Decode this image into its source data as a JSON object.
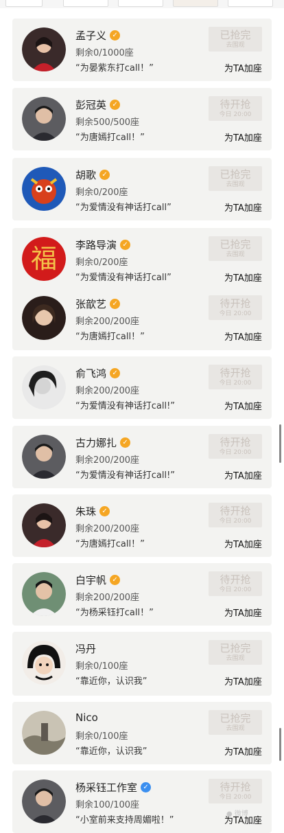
{
  "items": [
    {
      "name": "孟子义",
      "badge": "orange",
      "seats": "剩余0/1000座",
      "quote": "“为晏紫东打call！”",
      "status": "已抢完",
      "status_sub": "去围观",
      "action": "为TA加座",
      "avatar": "portrait-red"
    },
    {
      "name": "彭冠英",
      "badge": "orange",
      "seats": "剩余500/500座",
      "quote": "“为唐嫣打call！”",
      "status": "待开抢",
      "status_sub": "今日 20:00",
      "action": "为TA加座",
      "avatar": "portrait-dark"
    },
    {
      "name": "胡歌",
      "badge": "orange",
      "seats": "剩余0/200座",
      "quote": "“为爱情没有神话打call”",
      "status": "已抢完",
      "status_sub": "去围观",
      "action": "为TA加座",
      "avatar": "cartoon-monster"
    },
    {
      "name": "李路导演",
      "badge": "orange",
      "seats": "剩余0/200座",
      "quote": "“为爱情没有神话打call”",
      "status": "已抢完",
      "status_sub": "去围观",
      "action": "为TA加座",
      "avatar": "fu-character"
    },
    {
      "name": "张歆艺",
      "badge": "orange",
      "seats": "剩余200/200座",
      "quote": "“为唐嫣打call！”",
      "status": "待开抢",
      "status_sub": "今日 20:00",
      "action": "为TA加座",
      "avatar": "portrait-warm"
    },
    {
      "name": "俞飞鸿",
      "badge": "orange",
      "seats": "剩余200/200座",
      "quote": "“为爱情没有神话打call!”",
      "status": "待开抢",
      "status_sub": "今日 20:00",
      "action": "为TA加座",
      "avatar": "portrait-bw"
    },
    {
      "name": "古力娜扎",
      "badge": "orange",
      "seats": "剩余200/200座",
      "quote": "“为爱情没有神话打call!”",
      "status": "待开抢",
      "status_sub": "今日 20:00",
      "action": "为TA加座",
      "avatar": "portrait-dark"
    },
    {
      "name": "朱珠",
      "badge": "orange",
      "seats": "剩余200/200座",
      "quote": "“为唐嫣打call！”",
      "status": "待开抢",
      "status_sub": "今日 20:00",
      "action": "为TA加座",
      "avatar": "portrait-red"
    },
    {
      "name": "白宇帆",
      "badge": "orange",
      "seats": "剩余200/200座",
      "quote": "“为杨采钰打call！”",
      "status": "待开抢",
      "status_sub": "今日 20:00",
      "action": "为TA加座",
      "avatar": "portrait-green"
    },
    {
      "name": "冯丹",
      "badge": "none",
      "seats": "剩余0/100座",
      "quote": "“靠近你，认识我”",
      "status": "已抢完",
      "status_sub": "去围观",
      "action": "为TA加座",
      "avatar": "cartoon-girl"
    },
    {
      "name": "Nico",
      "badge": "none",
      "seats": "剩余0/100座",
      "quote": "“靠近你，认识我”",
      "status": "已抢完",
      "status_sub": "去围观",
      "action": "为TA加座",
      "avatar": "landscape"
    },
    {
      "name": "杨采钰工作室",
      "badge": "blue",
      "seats": "剩余100/100座",
      "quote": "“小室前来支持周媚啦！”",
      "status": "待开抢",
      "status_sub": "今日 20:00",
      "action": "为TA加座",
      "avatar": "portrait-dark"
    }
  ],
  "colors": {
    "badge_orange": "#f5a623",
    "badge_blue": "#3b8ff0",
    "status_bg": "#e8e6e3",
    "status_text": "#c9c2bc",
    "card_bg": "#f3f3f1"
  }
}
